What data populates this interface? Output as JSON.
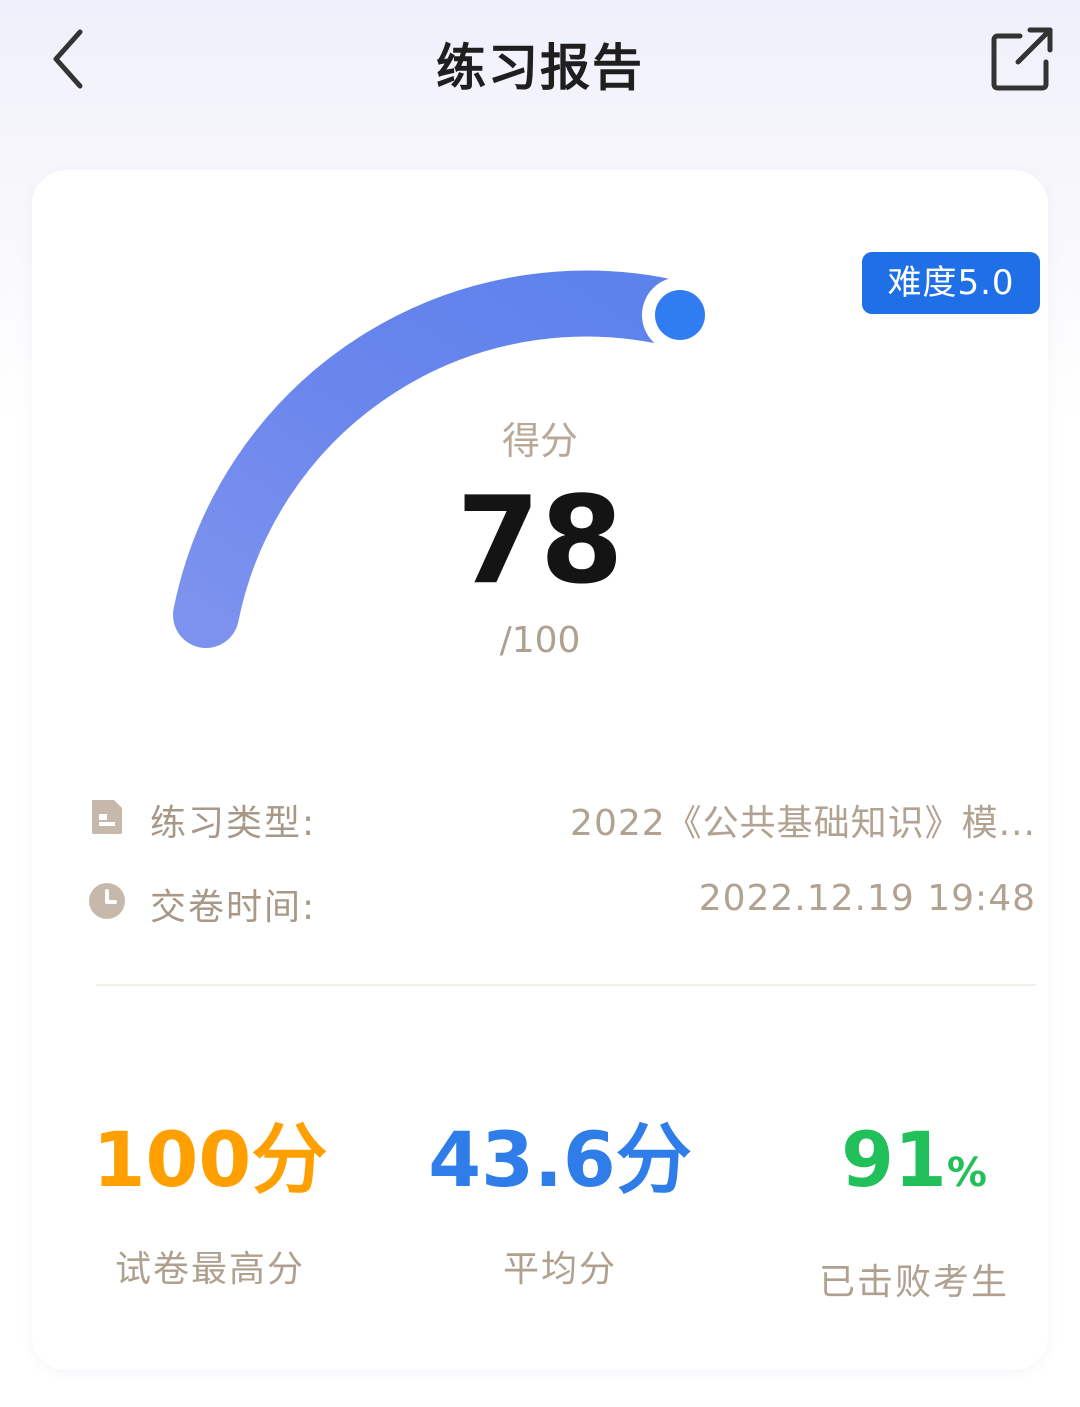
{
  "header": {
    "title": "练习报告",
    "back_icon": "chevron-left-icon",
    "share_icon": "share-external-icon"
  },
  "score_card": {
    "difficulty_badge": "难度5.0",
    "score_label": "得分",
    "score": "78",
    "total": "/100",
    "gauge_progress": 0.78,
    "gauge_color": "#6f8ef0",
    "knob_color": "#2f7df0"
  },
  "info": {
    "type_label": "练习类型:",
    "type_value": "2022《公共基础知识》模...",
    "time_label": "交卷时间:",
    "time_value": "2022.12.19 19:48"
  },
  "stats": [
    {
      "value": "100分",
      "label": "试卷最高分",
      "color": "#ff9f00"
    },
    {
      "value": "43.6分",
      "label": "平均分",
      "color": "#2f7de8"
    },
    {
      "value": "91",
      "unit": "%",
      "label": "已击败考生",
      "color": "#22c05a"
    }
  ]
}
